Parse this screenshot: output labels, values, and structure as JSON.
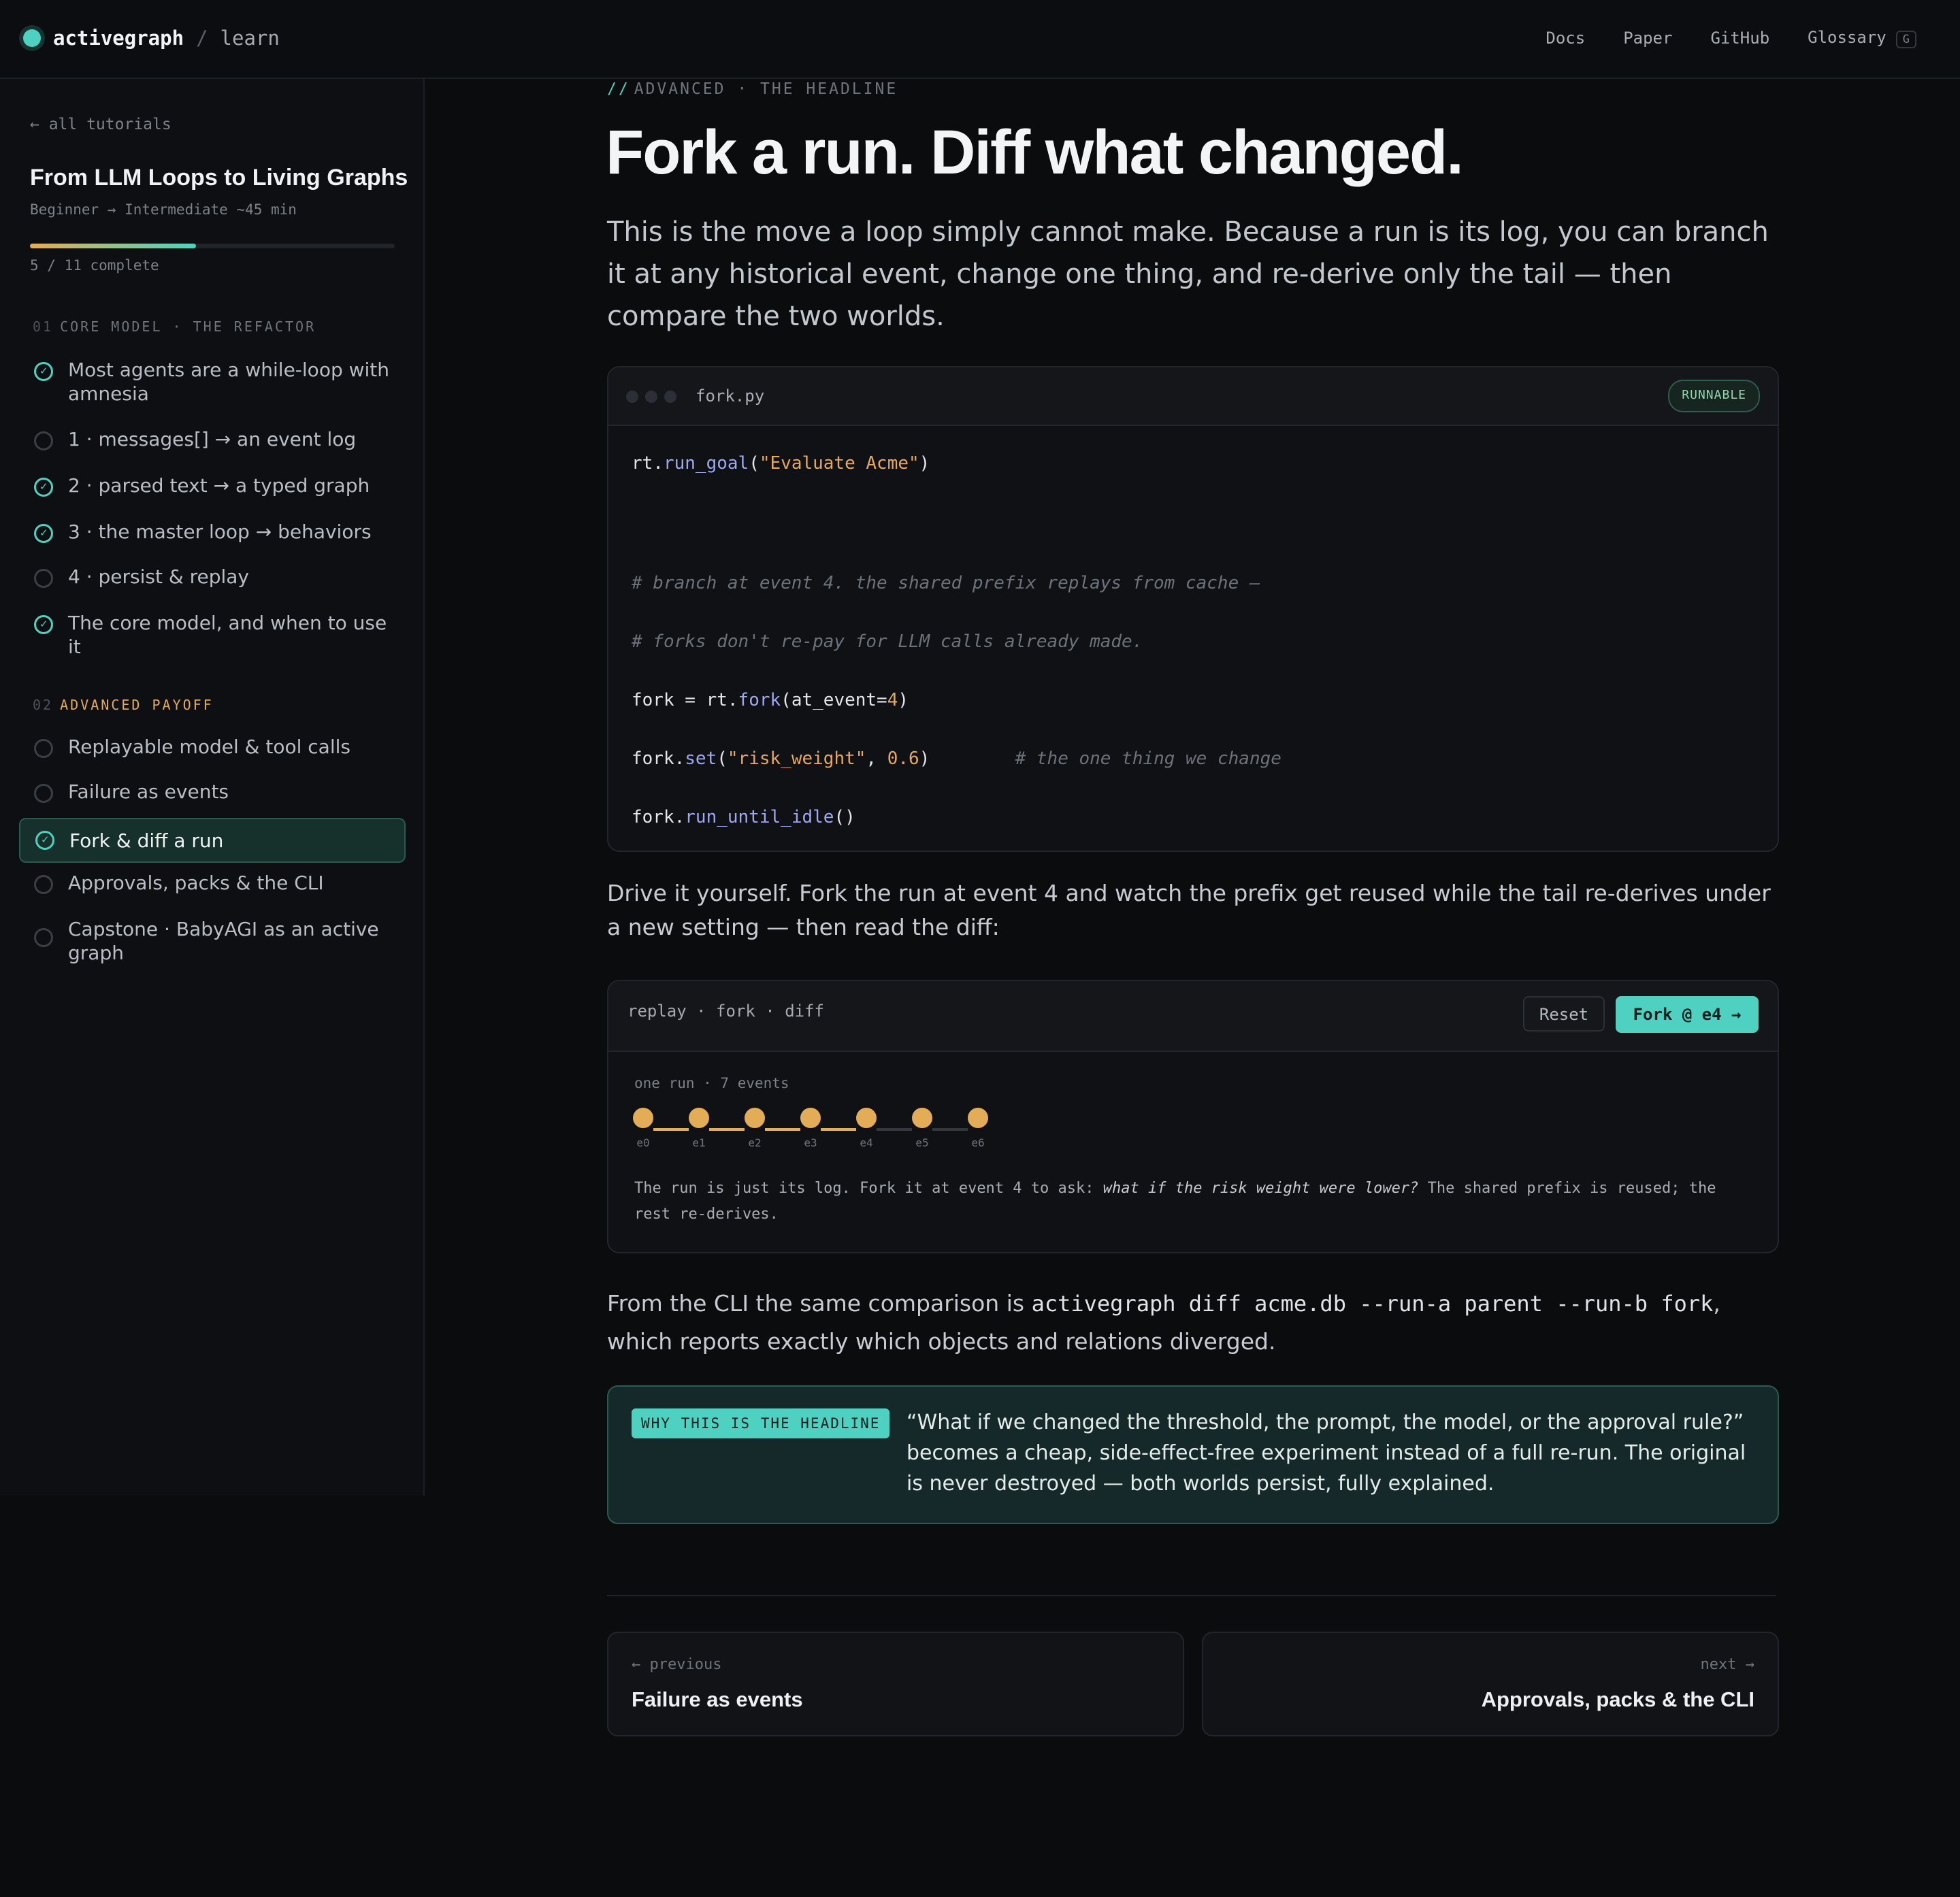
{
  "topbar": {
    "brand": "activegraph",
    "separator": "/",
    "section": "learn",
    "nav": [
      {
        "label": "Docs"
      },
      {
        "label": "Paper"
      },
      {
        "label": "GitHub"
      },
      {
        "label": "Glossary",
        "kbd": "G"
      }
    ]
  },
  "sidebar": {
    "back_link": "← all tutorials",
    "course_title": "From LLM Loops to Living Graphs",
    "course_meta": "Beginner → Intermediate  ~45 min",
    "progress": {
      "completed": 5,
      "total": 11,
      "label": "5 / 11 complete"
    },
    "sections": [
      {
        "number": "01",
        "title": "CORE MODEL · THE REFACTOR",
        "color": "#6f757d",
        "lessons": [
          {
            "label": "Most agents are a while-loop with amnesia",
            "done": true
          },
          {
            "label": "1 · messages[] → an event log",
            "done": false
          },
          {
            "label": "2 · parsed text → a typed graph",
            "done": true
          },
          {
            "label": "3 · the master loop → behaviors",
            "done": true
          },
          {
            "label": "4 · persist & replay",
            "done": false
          },
          {
            "label": "The core model, and when to use it",
            "done": true
          }
        ]
      },
      {
        "number": "02",
        "title": "ADVANCED PAYOFF",
        "color": "#e3ad57",
        "lessons": [
          {
            "label": "Replayable model & tool calls",
            "done": false
          },
          {
            "label": "Failure as events",
            "done": false
          },
          {
            "label": "Fork & diff a run",
            "done": true,
            "active": true
          },
          {
            "label": "Approvals, packs & the CLI",
            "done": false
          },
          {
            "label": "Capstone · BabyAGI as an active graph",
            "done": false
          }
        ]
      }
    ]
  },
  "main": {
    "eyebrow_slashes": "//",
    "eyebrow": "ADVANCED · THE HEADLINE",
    "title": "Fork a run. Diff what changed.",
    "lede": "This is the move a loop simply cannot make. Because a run is its log, you can branch it at any historical event, change one thing, and re-derive only the tail — then compare the two worlds.",
    "code_card": {
      "filename": "fork.py",
      "badge": "RUNNABLE",
      "lines": [
        [
          {
            "t": "rt."
          },
          {
            "t": "run_goal",
            "c": "fn"
          },
          {
            "t": "("
          },
          {
            "t": "\"Evaluate Acme\"",
            "c": "str"
          },
          {
            "t": ")"
          }
        ],
        [],
        [
          {
            "t": "# branch at event 4. the shared prefix replays from cache —",
            "c": "com"
          }
        ],
        [
          {
            "t": "# forks don't re-pay for LLM calls already made.",
            "c": "com"
          }
        ],
        [
          {
            "t": "fork = rt."
          },
          {
            "t": "fork",
            "c": "fn"
          },
          {
            "t": "(at_event="
          },
          {
            "t": "4",
            "c": "num"
          },
          {
            "t": ")"
          }
        ],
        [
          {
            "t": "fork."
          },
          {
            "t": "set",
            "c": "fn"
          },
          {
            "t": "("
          },
          {
            "t": "\"risk_weight\"",
            "c": "str"
          },
          {
            "t": ", "
          },
          {
            "t": "0.6",
            "c": "num"
          },
          {
            "t": ")        "
          },
          {
            "t": "# the one thing we change",
            "c": "com"
          }
        ],
        [
          {
            "t": "fork."
          },
          {
            "t": "run_until_idle",
            "c": "fn"
          },
          {
            "t": "()"
          }
        ]
      ]
    },
    "drive_text": "Drive it yourself. Fork the run at event 4 and watch the prefix get reused while the tail re-derives under a new setting — then read the diff:",
    "sim": {
      "title": "replay · fork · diff",
      "reset_label": "Reset",
      "fork_label": "Fork @ e4 →",
      "run_label": "one run · 7 events",
      "events": [
        "e0",
        "e1",
        "e2",
        "e3",
        "e4",
        "e5",
        "e6"
      ],
      "description_before": "The run is just its log. Fork it at event 4 to ask: ",
      "description_em": "what if the risk weight were lower?",
      "description_after": " The shared prefix is reused; the rest re-derives."
    },
    "cli_text_before": "From the CLI the same comparison is ",
    "cli_command": "activegraph diff acme.db --run-a parent --run-b fork",
    "cli_text_after": ", which reports exactly which objects and relations diverged.",
    "callout": {
      "tag": "WHY THIS IS THE HEADLINE",
      "text": "“What if we changed the threshold, the prompt, the model, or the approval rule?” becomes a cheap, side-effect-free experiment instead of a full re-run. The original is never destroyed — both worlds persist, fully explained."
    },
    "pager": {
      "prev_kicker": "← previous",
      "prev_title": "Failure as events",
      "next_kicker": "next →",
      "next_title": "Approvals, packs & the CLI"
    }
  },
  "colors": {
    "accent": "#4fd1c1",
    "amber": "#e3ad57",
    "background": "#0b0c0e"
  }
}
